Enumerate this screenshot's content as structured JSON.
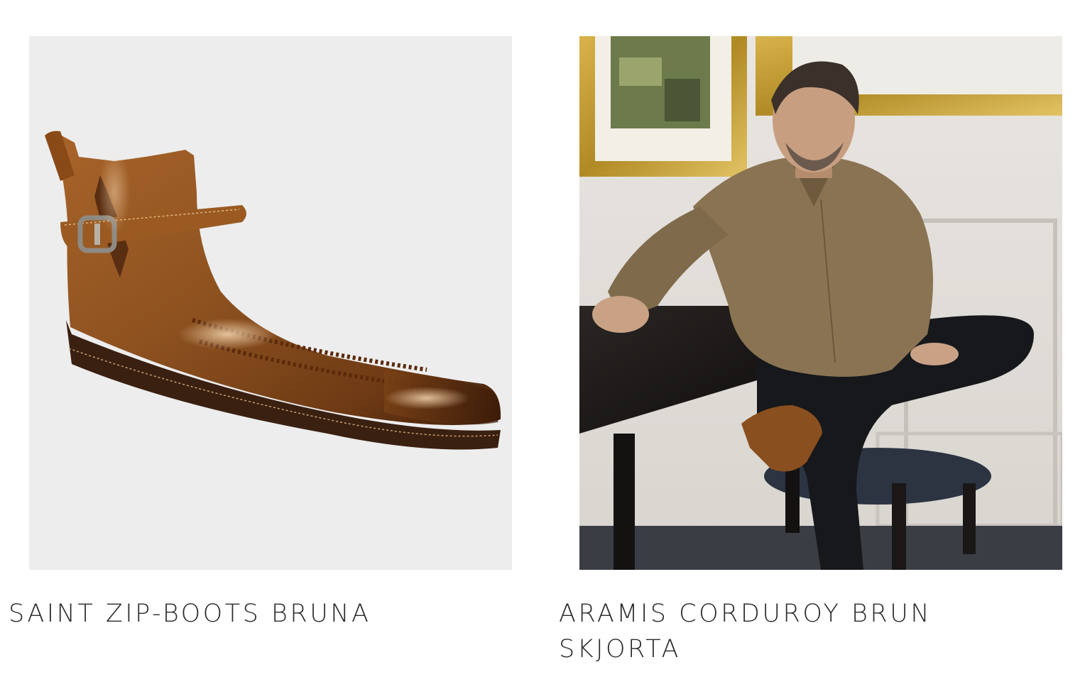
{
  "products": [
    {
      "title": "SAINT ZIP-BOOTS BRUNA",
      "image": "brown-leather-zip-boot-with-buckle-strap"
    },
    {
      "title": "ARAMIS CORDUROY BRUN SKJORTA",
      "image": "man-in-brown-corduroy-shirt-seated-at-table"
    }
  ],
  "colors": {
    "text": "#2a2a2a",
    "background": "#ffffff",
    "boot_leather": "#8a4f1e",
    "shirt": "#8a7352"
  }
}
